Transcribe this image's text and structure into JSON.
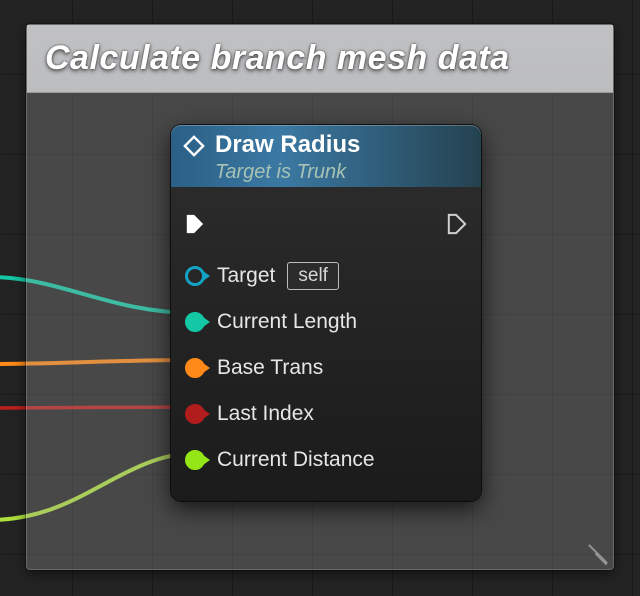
{
  "comment": {
    "title": "Calculate branch mesh data"
  },
  "node": {
    "title": "Draw Radius",
    "subtitle": "Target is Trunk",
    "pins_in": [
      {
        "id": "exec_in",
        "kind": "exec",
        "label": "",
        "color": "white",
        "connected": true
      },
      {
        "id": "target",
        "kind": "object",
        "label": "Target",
        "color": "blue",
        "connected": false,
        "default": "self"
      },
      {
        "id": "curlen",
        "kind": "float",
        "label": "Current Length",
        "color": "teal",
        "connected": true
      },
      {
        "id": "basetr",
        "kind": "trans",
        "label": "Base Trans",
        "color": "orange",
        "connected": true
      },
      {
        "id": "lastidx",
        "kind": "int",
        "label": "Last Index",
        "color": "red",
        "connected": true
      },
      {
        "id": "curdist",
        "kind": "float",
        "label": "Current Distance",
        "color": "green",
        "connected": true
      }
    ],
    "pins_out": [
      {
        "id": "exec_out",
        "kind": "exec",
        "label": "",
        "color": "white",
        "connected": false
      }
    ]
  }
}
